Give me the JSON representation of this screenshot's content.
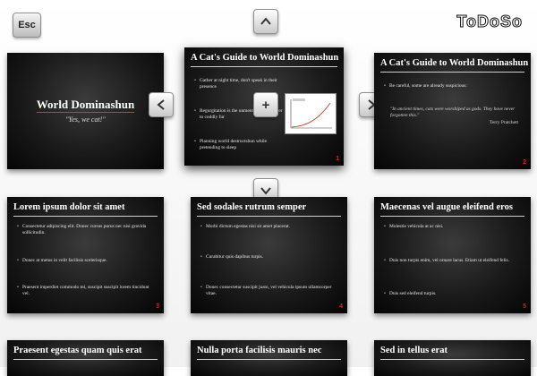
{
  "brand": "ToDoSo",
  "keys": {
    "esc": "Esc",
    "up": "arrow-up",
    "down": "arrow-down",
    "left": "arrow-left",
    "right": "arrow-right",
    "add": "+"
  },
  "accent": {
    "red": "#e0201c"
  },
  "slides": [
    {
      "title": "World Dominashun",
      "subtitle": "\"Yes, we cat!\""
    },
    {
      "title": "A Cat's Guide to World Dominashun",
      "bullets": [
        "Gather at night time, don't speak in their presence",
        "Regurgitation is the unmentionable answer to coddly fur",
        "Planning world destructshun while pretending to sleep"
      ],
      "number": "1"
    },
    {
      "title": "A Cat's Guide to World Dominashun",
      "bullets": [
        "Be careful, some are already suspicious:"
      ],
      "quote": "\"In ancient times, cats were worshiped as gods. They have never forgotten this.\"",
      "attribution": "Terry Pratchett",
      "number": "2"
    },
    {
      "title": "Lorem ipsum dolor sit amet",
      "bullets": [
        "Consectetur adipiscing elit. Donec cursus purus nec nisi gravida sollicitudin.",
        "Donec at metus in velit facilisis scelerisque.",
        "Praesent imperdiet commodo mi, suscipit suscipit lorem tincidunt vel."
      ],
      "number": "3"
    },
    {
      "title": "Sed sodales rutrum semper",
      "bullets": [
        "Morbi dictum egestas nisi sit amet placerat.",
        "Curabitur quis dapibus turpis.",
        "Donec consectetur suscipit justo, vel vehicula ipsum ullamcorper vitae."
      ],
      "number": "4"
    },
    {
      "title": "Maecenas vel augue eleifend eros",
      "bullets": [
        "Molestie vehicula at ac nisi.",
        "Duis non turpis enim, vel ornare lacus. Etiam ut eleifend felis.",
        "Duis sed eleifend turpis."
      ],
      "number": "5"
    },
    {
      "title": "Praesent egestas quam quis erat"
    },
    {
      "title": "Nulla porta facilisis mauris nec"
    },
    {
      "title": "Sed in tellus erat"
    }
  ]
}
